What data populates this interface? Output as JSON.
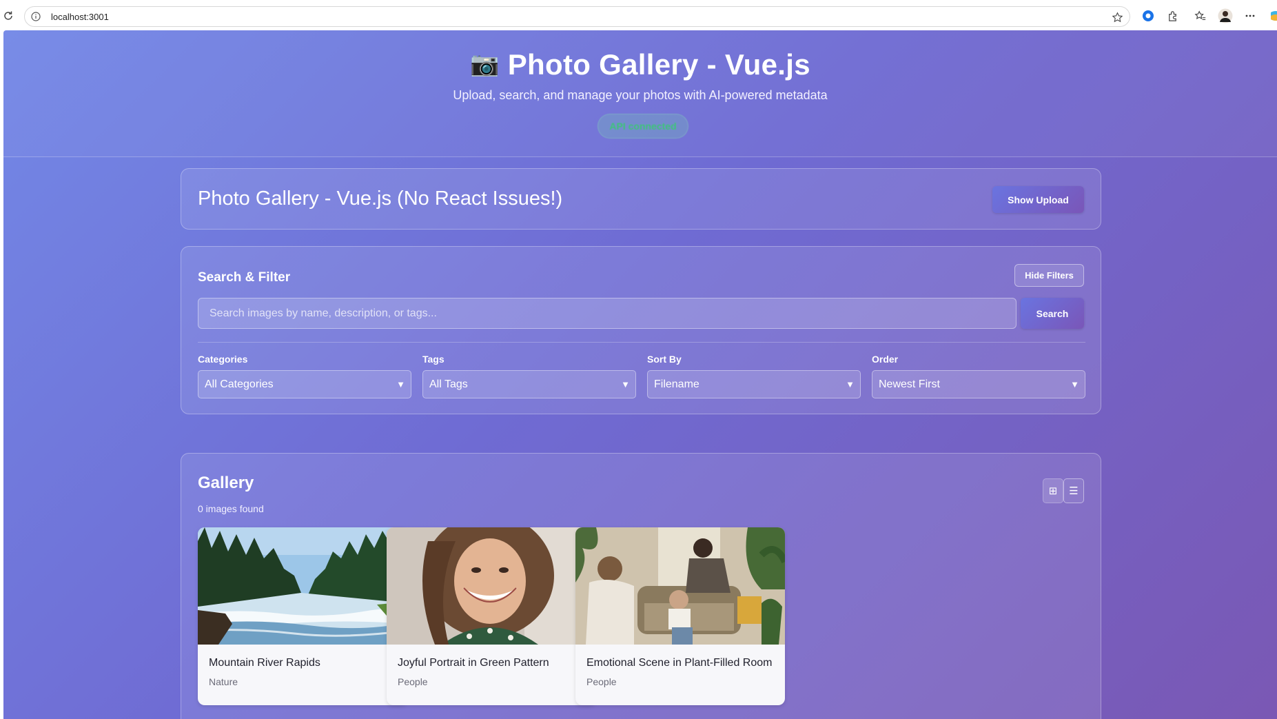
{
  "browser": {
    "url": "localhost:3001"
  },
  "hero": {
    "icon": "camera-emoji",
    "camera_glyph": "📷",
    "title": "Photo Gallery - Vue.js",
    "subtitle": "Upload, search, and manage your photos with AI-powered metadata",
    "api_status": "API connected"
  },
  "header_card": {
    "title": "Photo Gallery - Vue.js (No React Issues!)",
    "show_upload_label": "Show Upload"
  },
  "filters": {
    "title": "Search & Filter",
    "hide_label": "Hide Filters",
    "search_placeholder": "Search images by name, description, or tags...",
    "search_value": "",
    "search_button": "Search",
    "groups": [
      {
        "label": "Categories",
        "value": "All Categories"
      },
      {
        "label": "Tags",
        "value": "All Tags"
      },
      {
        "label": "Sort By",
        "value": "Filename"
      },
      {
        "label": "Order",
        "value": "Newest First"
      }
    ]
  },
  "gallery": {
    "title": "Gallery",
    "count_text": "0 images found",
    "grid_icon": "grid-icon",
    "list_icon": "list-icon",
    "photos": [
      {
        "title": "Mountain River Rapids",
        "category": "Nature"
      },
      {
        "title": "Joyful Portrait in Green Pattern",
        "category": "People"
      },
      {
        "title": "Emotional Scene in Plant-Filled Room",
        "category": "People"
      }
    ]
  },
  "colors": {
    "gradient_start": "#7388e6",
    "gradient_mid": "#6f6bd3",
    "gradient_end": "#7a58b4",
    "api_status_green": "#3ec47a"
  }
}
